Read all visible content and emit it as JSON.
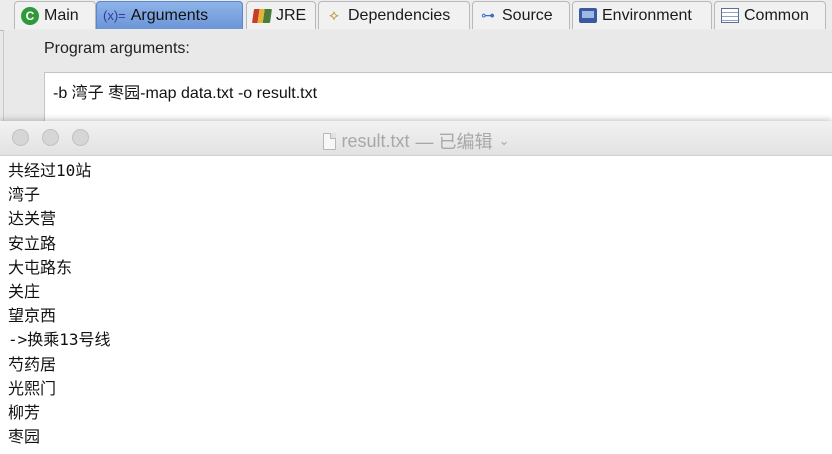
{
  "tabs": [
    {
      "label": "Main",
      "icon": "main-class-icon",
      "active": false
    },
    {
      "label": "Arguments",
      "icon_text": "(x)=",
      "icon": "arguments-icon",
      "active": true
    },
    {
      "label": "JRE",
      "icon": "jre-library-icon",
      "active": false
    },
    {
      "label": "Dependencies",
      "icon": "dependencies-icon",
      "active": false
    },
    {
      "label": "Source",
      "icon": "source-lookup-icon",
      "active": false
    },
    {
      "label": "Environment",
      "icon": "environment-icon",
      "active": false
    },
    {
      "label": "Common",
      "icon": "common-icon",
      "active": false
    }
  ],
  "arguments": {
    "program_label": "Program arguments:",
    "program_value": "-b 湾子 枣园-map data.txt -o result.txt"
  },
  "result_window": {
    "title": "result.txt",
    "status": "— 已编辑",
    "chevron": "⌄",
    "lines": [
      "共经过10站",
      "湾子",
      "达关营",
      "安立路",
      "大屯路东",
      "关庄",
      "望京西",
      "->换乘13号线",
      "芍药居",
      "光熙门",
      "柳芳",
      "枣园"
    ]
  },
  "colors": {
    "active_tab": "#7aa2e0",
    "window_title": "#a8a8a8"
  }
}
